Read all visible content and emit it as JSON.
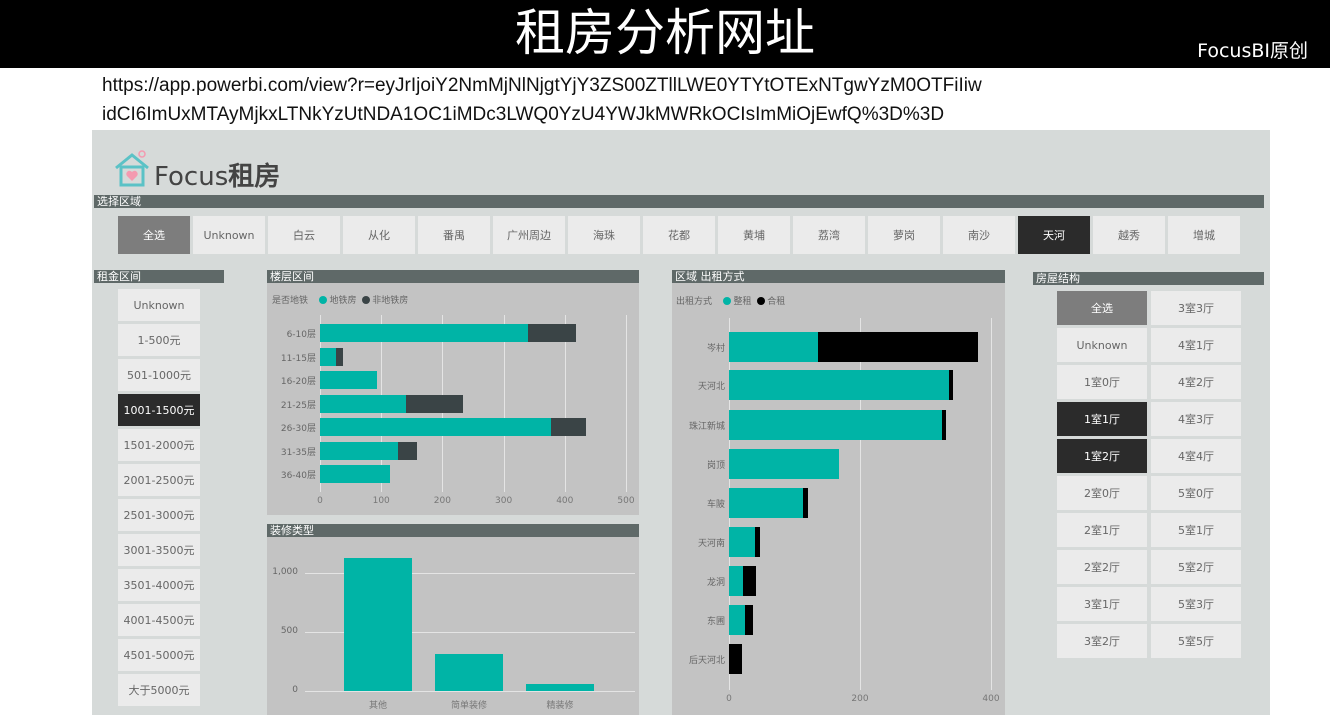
{
  "header": {
    "title": "租房分析网址",
    "brand": "FocusBI原创",
    "url_line1": "https://app.powerbi.com/view?r=eyJrIjoiY2NmMjNlNjgtYjY3ZS00ZTllLWE0YTYtOTExNTgwYzM0OTFiIiw",
    "url_line2": "idCI6ImUxMTAyMjkxLTNkYzUtNDA1OC1iMDc3LWQ0YzU4YWJkMWRkOCIsImMiOjEwfQ%3D%3D"
  },
  "logo": {
    "text_en": "Focus",
    "text_cn": "租房"
  },
  "colors": {
    "teal": "#00b4a6",
    "dark": "#3a4446",
    "black": "#000000",
    "header": "#5f6968"
  },
  "region_slicer": {
    "title": "选择区域",
    "items": [
      "全选",
      "Unknown",
      "白云",
      "从化",
      "番禺",
      "广州周边",
      "海珠",
      "花都",
      "黄埔",
      "荔湾",
      "萝岗",
      "南沙",
      "天河",
      "越秀",
      "增城"
    ],
    "selected": [
      "天河"
    ]
  },
  "rent_slicer": {
    "title": "租金区间",
    "items": [
      "Unknown",
      "1-500元",
      "501-1000元",
      "1001-1500元",
      "1501-2000元",
      "2001-2500元",
      "2501-3000元",
      "3001-3500元",
      "3501-4000元",
      "4001-4500元",
      "4501-5000元",
      "大于5000元"
    ],
    "selected": [
      "1001-1500元"
    ]
  },
  "room_slicer": {
    "title": "房屋结构",
    "col1": [
      "全选",
      "Unknown",
      "1室0厅",
      "1室1厅",
      "1室2厅",
      "2室0厅",
      "2室1厅",
      "2室2厅",
      "3室1厅",
      "3室2厅"
    ],
    "col2": [
      "3室3厅",
      "4室1厅",
      "4室2厅",
      "4室3厅",
      "4室4厅",
      "5室0厅",
      "5室1厅",
      "5室2厅",
      "5室3厅",
      "5室5厅"
    ],
    "selected": [
      "1室1厅",
      "1室2厅"
    ]
  },
  "chart_data": [
    {
      "type": "bar",
      "orientation": "horizontal",
      "stacked": true,
      "title": "楼层区间",
      "legend_title": "是否地铁",
      "legend_position": "top-left",
      "categories": [
        "6-10层",
        "11-15层",
        "16-20层",
        "21-25层",
        "26-30层",
        "31-35层",
        "36-40层"
      ],
      "series": [
        {
          "name": "地铁房",
          "color": "#00b4a6",
          "values": [
            340,
            26,
            93,
            141,
            377,
            127,
            114
          ]
        },
        {
          "name": "非地铁房",
          "color": "#3a4446",
          "values": [
            78,
            11,
            0,
            93,
            58,
            31,
            0
          ]
        }
      ],
      "xlim": [
        0,
        500
      ],
      "xticks": [
        "0",
        "100",
        "200",
        "300",
        "400",
        "500"
      ],
      "grid": true
    },
    {
      "type": "bar",
      "orientation": "horizontal",
      "stacked": true,
      "title": "区域 出租方式",
      "legend_title": "出租方式",
      "legend_position": "top-left",
      "categories": [
        "岑村",
        "天河北",
        "珠江新城",
        "岗顶",
        "车陂",
        "天河南",
        "龙洞",
        "东圃",
        "后天河北"
      ],
      "series": [
        {
          "name": "整租",
          "color": "#00b4a6",
          "values": [
            136,
            336,
            325,
            168,
            113,
            40,
            21,
            24,
            0
          ]
        },
        {
          "name": "合租",
          "color": "#000000",
          "values": [
            244,
            6,
            6,
            0,
            7,
            7,
            20,
            13,
            20
          ]
        }
      ],
      "xlim": [
        0,
        400
      ],
      "xticks": [
        "0",
        "200",
        "400"
      ],
      "grid": true
    },
    {
      "type": "bar",
      "orientation": "vertical",
      "title": "装修类型",
      "categories": [
        "其他",
        "简单装修",
        "精装修"
      ],
      "values": [
        1125,
        312,
        55
      ],
      "ylim": [
        0,
        1200
      ],
      "yticks": [
        "0",
        "500",
        "1,000"
      ],
      "grid": true
    }
  ]
}
